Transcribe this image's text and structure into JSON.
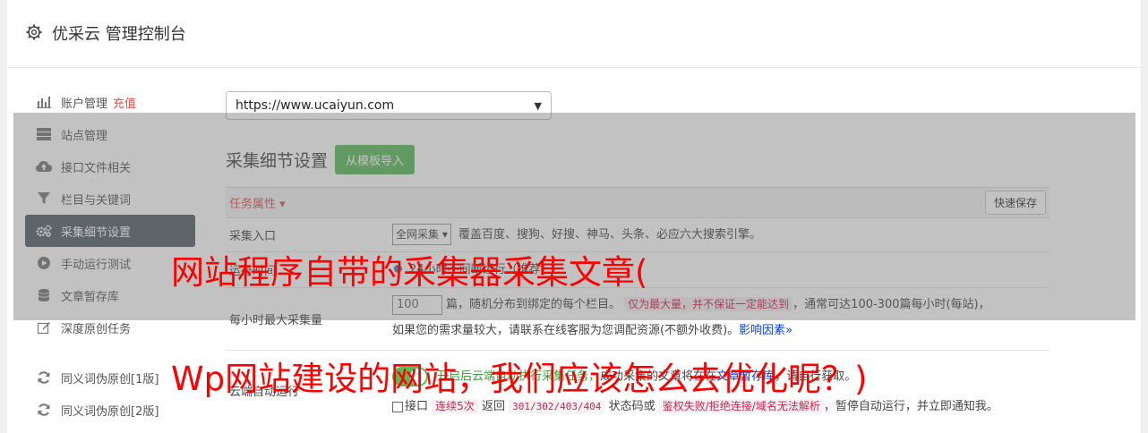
{
  "header": {
    "title": "优采云 管理控制台",
    "icon": "gear-icon"
  },
  "sidebar": {
    "items": [
      {
        "label": "账户管理",
        "extra": "充值",
        "icon": "bar-chart-icon"
      },
      {
        "label": "站点管理",
        "icon": "server-icon"
      },
      {
        "label": "接口文件相关",
        "icon": "cloud-upload-icon"
      },
      {
        "label": "栏目与关键词",
        "icon": "filter-icon"
      },
      {
        "label": "采集细节设置",
        "icon": "gears-icon",
        "active": true
      },
      {
        "label": "手动运行测试",
        "icon": "play-icon"
      },
      {
        "label": "文章暂存库",
        "icon": "database-icon"
      },
      {
        "label": "深度原创任务",
        "icon": "edit-icon"
      },
      {
        "label": "同义词伪原创[1版]",
        "icon": "refresh-icon"
      },
      {
        "label": "同义词伪原创[2版]",
        "icon": "refresh-icon"
      }
    ]
  },
  "site_select": {
    "value": "https://www.ucaiyun.com"
  },
  "section": {
    "title": "采集细节设置",
    "import_button": "从模板导入"
  },
  "task_bar": {
    "attr_label": "任务属性 ▾",
    "quick_save": "快速保存"
  },
  "rows": {
    "entry": {
      "label": "采集入口",
      "select": "全网采集",
      "desc": "覆盖百度、搜狗、好搜、神马、头条、必应六大搜索引擎。"
    },
    "time": {
      "label": "运行时间",
      "desc": "24小时不间断运行（推荐）"
    },
    "max": {
      "label": "每小时最大采集量",
      "value": "100",
      "text1": "篇，随机分布到绑定的每个栏目。",
      "tag1": "仅为最大量，并不保证一定能达到",
      "text2": "，通常可达100-300篇每小时(每站)，",
      "text3": "如果您的需求量较大，请联系在线客服为您调配资源(不额外收费)。",
      "link": "影响因素"
    },
    "cloud": {
      "label": "云端自动运行",
      "desc1": "开启后云端自动执行采集任务，",
      "desc2": "成功采集的文章将在在",
      "link": "文章暂存库",
      "desc3": "，请自行获取。",
      "cb_label": "接口",
      "tag_times": "连续5次",
      "text_return": "返回",
      "tag_codes": "301/302/403/404",
      "text_or": "状态码或",
      "tag_fail": "鉴权失败/拒绝连接/域名无法解析",
      "text_end": "，暂停自动运行，并立即通知我。"
    }
  },
  "overlay_text": {
    "line1": "网站程序自带的采集器采集文章(",
    "line2": "Wp网站建设的网站，我们应该怎么去优化呢？)"
  }
}
